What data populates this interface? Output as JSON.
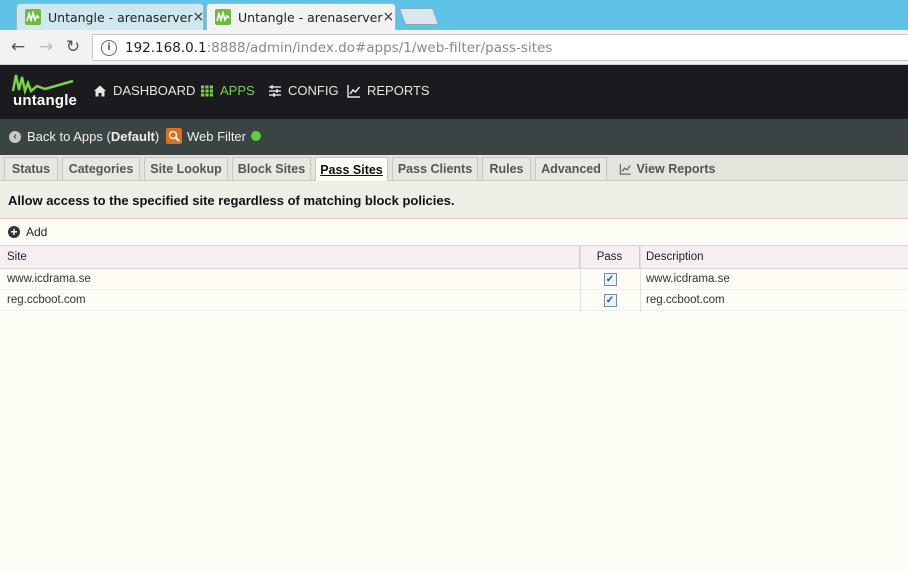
{
  "browser": {
    "tabs": [
      {
        "title": "Untangle - arenaserver",
        "close": "×"
      },
      {
        "title": "Untangle - arenaserver",
        "close": "×"
      }
    ],
    "url_host": "192.168.0.1",
    "url_path": ":8888/admin/index.do#apps/1/web-filter/pass-sites"
  },
  "header": {
    "logo_text": "untangle",
    "nav": [
      {
        "label": "DASHBOARD",
        "icon": "home-icon"
      },
      {
        "label": "APPS",
        "icon": "grid-icon",
        "active": true
      },
      {
        "label": "CONFIG",
        "icon": "sliders-icon"
      },
      {
        "label": "REPORTS",
        "icon": "chart-icon"
      }
    ]
  },
  "subheader": {
    "back_prefix": "Back to Apps (",
    "back_policy": "Default",
    "back_suffix": ")",
    "app_name": "Web Filter"
  },
  "tabs": [
    "Status",
    "Categories",
    "Site Lookup",
    "Block Sites",
    "Pass Sites",
    "Pass Clients",
    "Rules",
    "Advanced",
    "View Reports"
  ],
  "active_tab": "Pass Sites",
  "description": "Allow access to the specified site regardless of matching block policies.",
  "grid": {
    "add_label": "Add",
    "columns": {
      "site": "Site",
      "pass": "Pass",
      "description": "Description"
    },
    "rows": [
      {
        "site": "www.icdrama.se",
        "pass": true,
        "description": "www.icdrama.se"
      },
      {
        "site": "reg.ccboot.com",
        "pass": true,
        "description": "reg.ccboot.com"
      }
    ]
  },
  "colors": {
    "accent_green": "#7bd33f",
    "header_bg": "#1b1a1f",
    "subheader_bg": "#3a4444"
  }
}
